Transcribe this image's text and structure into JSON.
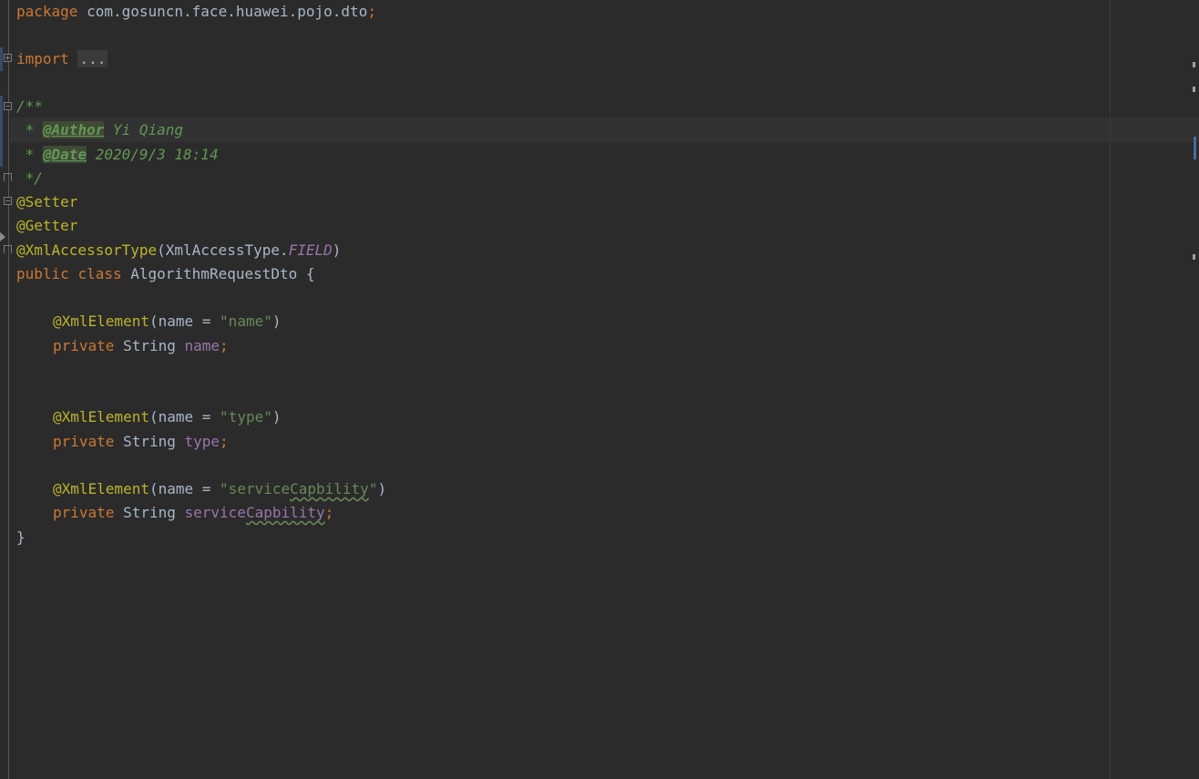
{
  "editor": {
    "lines": {
      "package_kw": "package",
      "package_name": " com.gosuncn.face.huawei.pojo.dto",
      "package_semi": ";",
      "import_kw": "import",
      "import_folded": "...",
      "doc_open": "/**",
      "doc_star1": " * ",
      "doc_author_tag": "@Author",
      "doc_author_val": " Yi Qiang",
      "doc_star2": " * ",
      "doc_date_tag": "@Date",
      "doc_date_val": " 2020/9/3 18:14",
      "doc_close": " */",
      "ann_setter": "@Setter",
      "ann_getter": "@Getter",
      "ann_xmlaccessor": "@XmlAccessorType",
      "ann_xmlaccessor_open": "(XmlAccessType.",
      "ann_xmlaccessor_field": "FIELD",
      "ann_xmlaccessor_close": ")",
      "class_public": "public",
      "class_class": "class",
      "class_name": " AlgorithmRequestDto {",
      "f1_ann": "@XmlElement",
      "f1_open": "(",
      "f1_param": "name",
      "f1_eq": " = ",
      "f1_str": "\"name\"",
      "f1_close": ")",
      "f1_private": "private",
      "f1_type": " String ",
      "f1_name": "name",
      "f1_semi": ";",
      "f2_ann": "@XmlElement",
      "f2_open": "(",
      "f2_param": "name",
      "f2_eq": " = ",
      "f2_str": "\"type\"",
      "f2_close": ")",
      "f2_private": "private",
      "f2_type": " String ",
      "f2_name": "type",
      "f2_semi": ";",
      "f3_ann": "@XmlElement",
      "f3_open": "(",
      "f3_param": "name",
      "f3_eq": " = ",
      "f3_str_a": "\"service",
      "f3_str_b": "Capbility",
      "f3_str_c": "\"",
      "f3_close": ")",
      "f3_private": "private",
      "f3_type": " String ",
      "f3_name_a": "service",
      "f3_name_b": "Capbility",
      "f3_semi": ";",
      "close_brace": "}"
    }
  },
  "colors": {
    "background": "#2b2b2b",
    "keyword": "#cc7832",
    "annotation": "#bbb529",
    "string": "#6a8759",
    "field": "#9876aa",
    "doc_comment": "#629755",
    "plain": "#a9b7c6"
  }
}
